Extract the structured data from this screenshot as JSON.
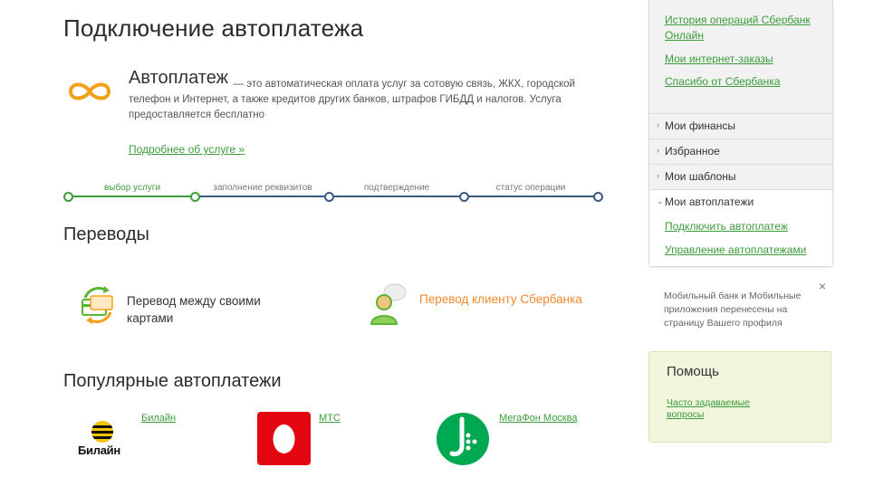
{
  "page_title": "Подключение автоплатежа",
  "intro": {
    "title": "Автоплатеж",
    "description": "— это автоматическая оплата услуг за сотовую связь, ЖКХ, городской телефон и Интернет, а также кредитов других банков, штрафов ГИБДД и налогов. Услуга предоставляется бесплатно",
    "more_link": "Подробнее об услуге »",
    "icon": "infinity-icon"
  },
  "steps": [
    {
      "label": "выбор услуги",
      "active": true
    },
    {
      "label": "заполнение реквизитов",
      "active": false
    },
    {
      "label": "подтверждение",
      "active": false
    },
    {
      "label": "статус операции",
      "active": false
    }
  ],
  "transfers": {
    "title": "Переводы",
    "items": [
      {
        "label": "Перевод между своими картами",
        "icon": "cards-transfer-icon"
      },
      {
        "label": "Перевод клиенту Сбербанка",
        "icon": "person-icon"
      }
    ]
  },
  "popular": {
    "title": "Популярные автоплатежи",
    "items": [
      {
        "label": "Билайн",
        "logo_text": "Билайн"
      },
      {
        "label": "МТС"
      },
      {
        "label": "МегаФон Москва"
      }
    ]
  },
  "sidebar": {
    "links": [
      "История операций Сбербанк Онлайн",
      "Мои интернет-заказы",
      "Спасибо от Сбербанка"
    ],
    "sections": [
      {
        "label": "Мои финансы"
      },
      {
        "label": "Избранное"
      },
      {
        "label": "Мои шаблоны"
      },
      {
        "label": "Мои автоплатежи"
      }
    ],
    "autopay_sub": [
      "Подключить автоплатеж",
      "Управление автоплатежами"
    ]
  },
  "notice": {
    "text": "Мобильный банк и Мобильные приложения перенесены на страницу Вашего профиля",
    "close": "×"
  },
  "help": {
    "title": "Помощь",
    "link": "Часто задаваемые вопросы"
  },
  "colors": {
    "accent_green": "#3c9c3c",
    "orange": "#f18a2c",
    "mts_red": "#e30611",
    "megafon_green": "#00a851",
    "step_blue": "#3a5a86"
  }
}
